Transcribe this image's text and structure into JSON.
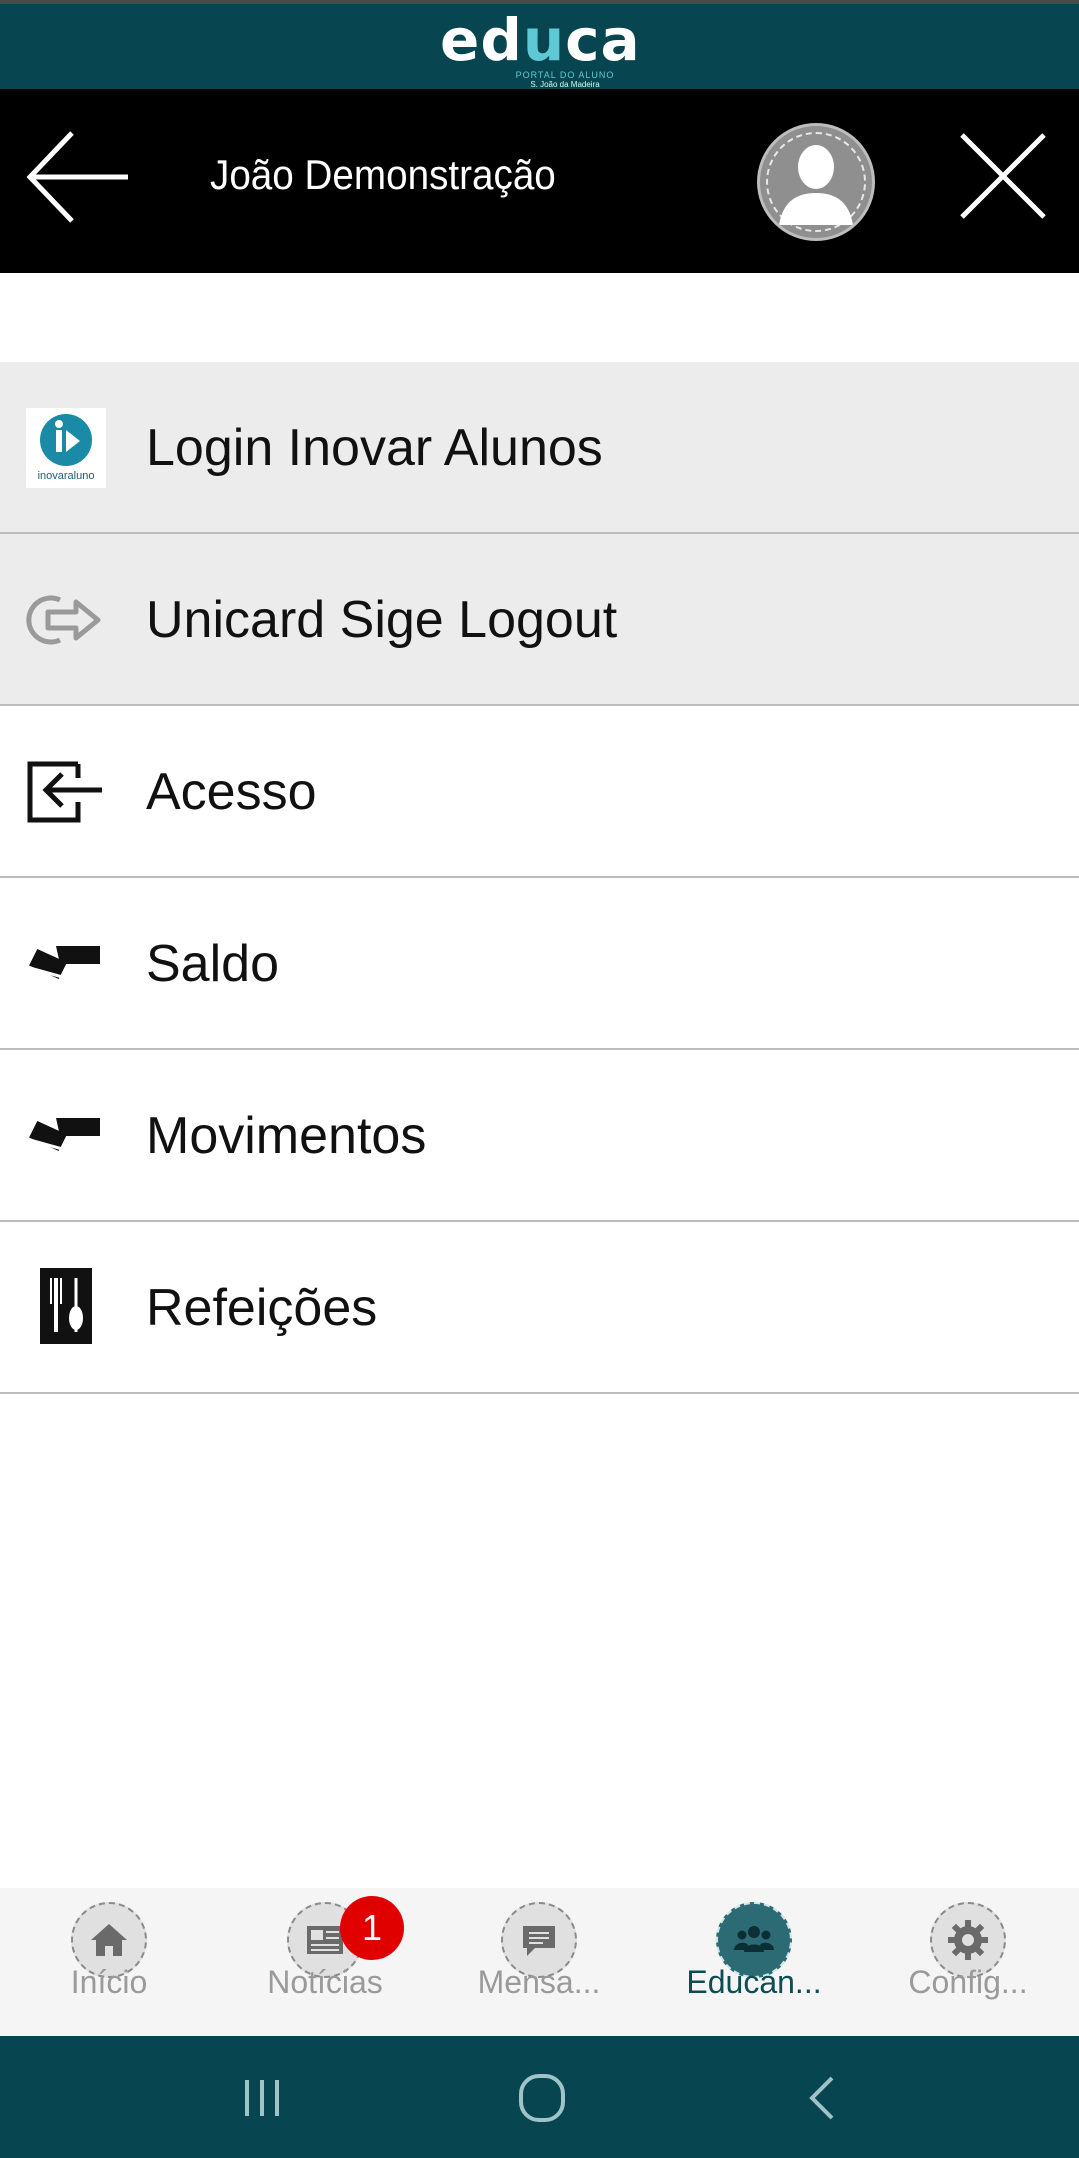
{
  "brand": {
    "logo_text_pre": "ed",
    "logo_text_u": "u",
    "logo_text_post": "ca",
    "logo_sub1": "PORTAL DO ALUNO",
    "logo_sub2": "S. João da Madeira",
    "colors": {
      "primary": "#074550",
      "accent": "#5ec9d4"
    }
  },
  "header": {
    "title": "João Demonstração",
    "back_icon": "arrow-left-icon",
    "avatar_icon": "user-avatar-icon",
    "close_icon": "close-icon"
  },
  "menu": {
    "items": [
      {
        "label": "Login Inovar Alunos",
        "icon": "inovar-alunos-icon",
        "icon_caption": "inovaraluno"
      },
      {
        "label": "Unicard Sige Logout",
        "icon": "logout-icon"
      },
      {
        "label": "Acesso",
        "icon": "login-icon"
      },
      {
        "label": "Saldo",
        "icon": "cards-icon"
      },
      {
        "label": "Movimentos",
        "icon": "cards-icon"
      },
      {
        "label": "Refeições",
        "icon": "cutlery-icon"
      }
    ]
  },
  "bottom_nav": {
    "items": [
      {
        "label": "Início",
        "icon": "home-icon",
        "active": false
      },
      {
        "label": "Notícias",
        "icon": "news-icon",
        "active": false,
        "badge": "1"
      },
      {
        "label": "Mensa...",
        "icon": "message-icon",
        "active": false
      },
      {
        "label": "Educan...",
        "icon": "group-icon",
        "active": true
      },
      {
        "label": "Config...",
        "icon": "gear-icon",
        "active": false
      }
    ]
  },
  "system_nav": {
    "recent": "recent-apps-icon",
    "home": "home-circle-icon",
    "back": "back-chevron-icon"
  }
}
